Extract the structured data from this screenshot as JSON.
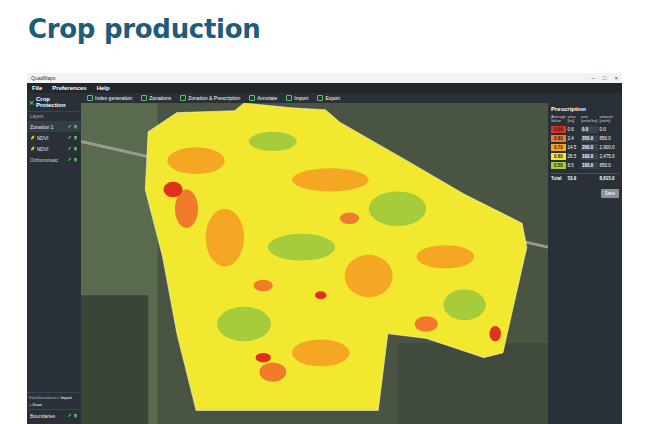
{
  "slide": {
    "title": "Crop production"
  },
  "window": {
    "title": "QuadMaps",
    "controls": [
      "–",
      "□",
      "×"
    ]
  },
  "menu": [
    "File",
    "Preferences",
    "Help"
  ],
  "sidebar": {
    "close": "✕",
    "title": "Crop Protection",
    "section": "Layers",
    "layers": [
      {
        "label": "Zonation 1",
        "kind": "zonation",
        "selected": true
      },
      {
        "label": "NDVI",
        "kind": "index",
        "selected": false
      },
      {
        "label": "NDVI",
        "kind": "index",
        "selected": false
      },
      {
        "label": "Orthomosaic",
        "kind": "raster",
        "selected": false
      }
    ],
    "boundaries": {
      "label": "Field boundaries",
      "buttons": [
        "Import",
        "+ Draw"
      ],
      "item": "Boundaries"
    }
  },
  "toolbar": [
    "Index generation",
    "Zonations",
    "Zonation & Prescription",
    "Annotate",
    "Import",
    "Export"
  ],
  "prescription": {
    "title": "Prescription",
    "columns": [
      "Average Value",
      "area [ha]",
      "rate [units/ha]",
      "amount [units]"
    ],
    "rows": [
      {
        "value": "0.90",
        "area": "0.6",
        "rate": "0.0",
        "amount": "0.0",
        "color": "#e0301e"
      },
      {
        "value": "0.80",
        "area": "2.4",
        "rate": "350.0",
        "amount": "850.0",
        "color": "#f07b2a"
      },
      {
        "value": "0.70",
        "area": "14.5",
        "rate": "200.0",
        "amount": "2,900.0",
        "color": "#f5a623"
      },
      {
        "value": "0.60",
        "area": "26.5",
        "rate": "100.0",
        "amount": "2,475.0",
        "color": "#f2e830"
      },
      {
        "value": "0.50",
        "area": "8.5",
        "rate": "100.0",
        "amount": "850.0",
        "color": "#a6cc3c"
      }
    ],
    "total": {
      "label": "Total",
      "area": "53.9",
      "amount": "8,615.0"
    },
    "button": "Save"
  }
}
